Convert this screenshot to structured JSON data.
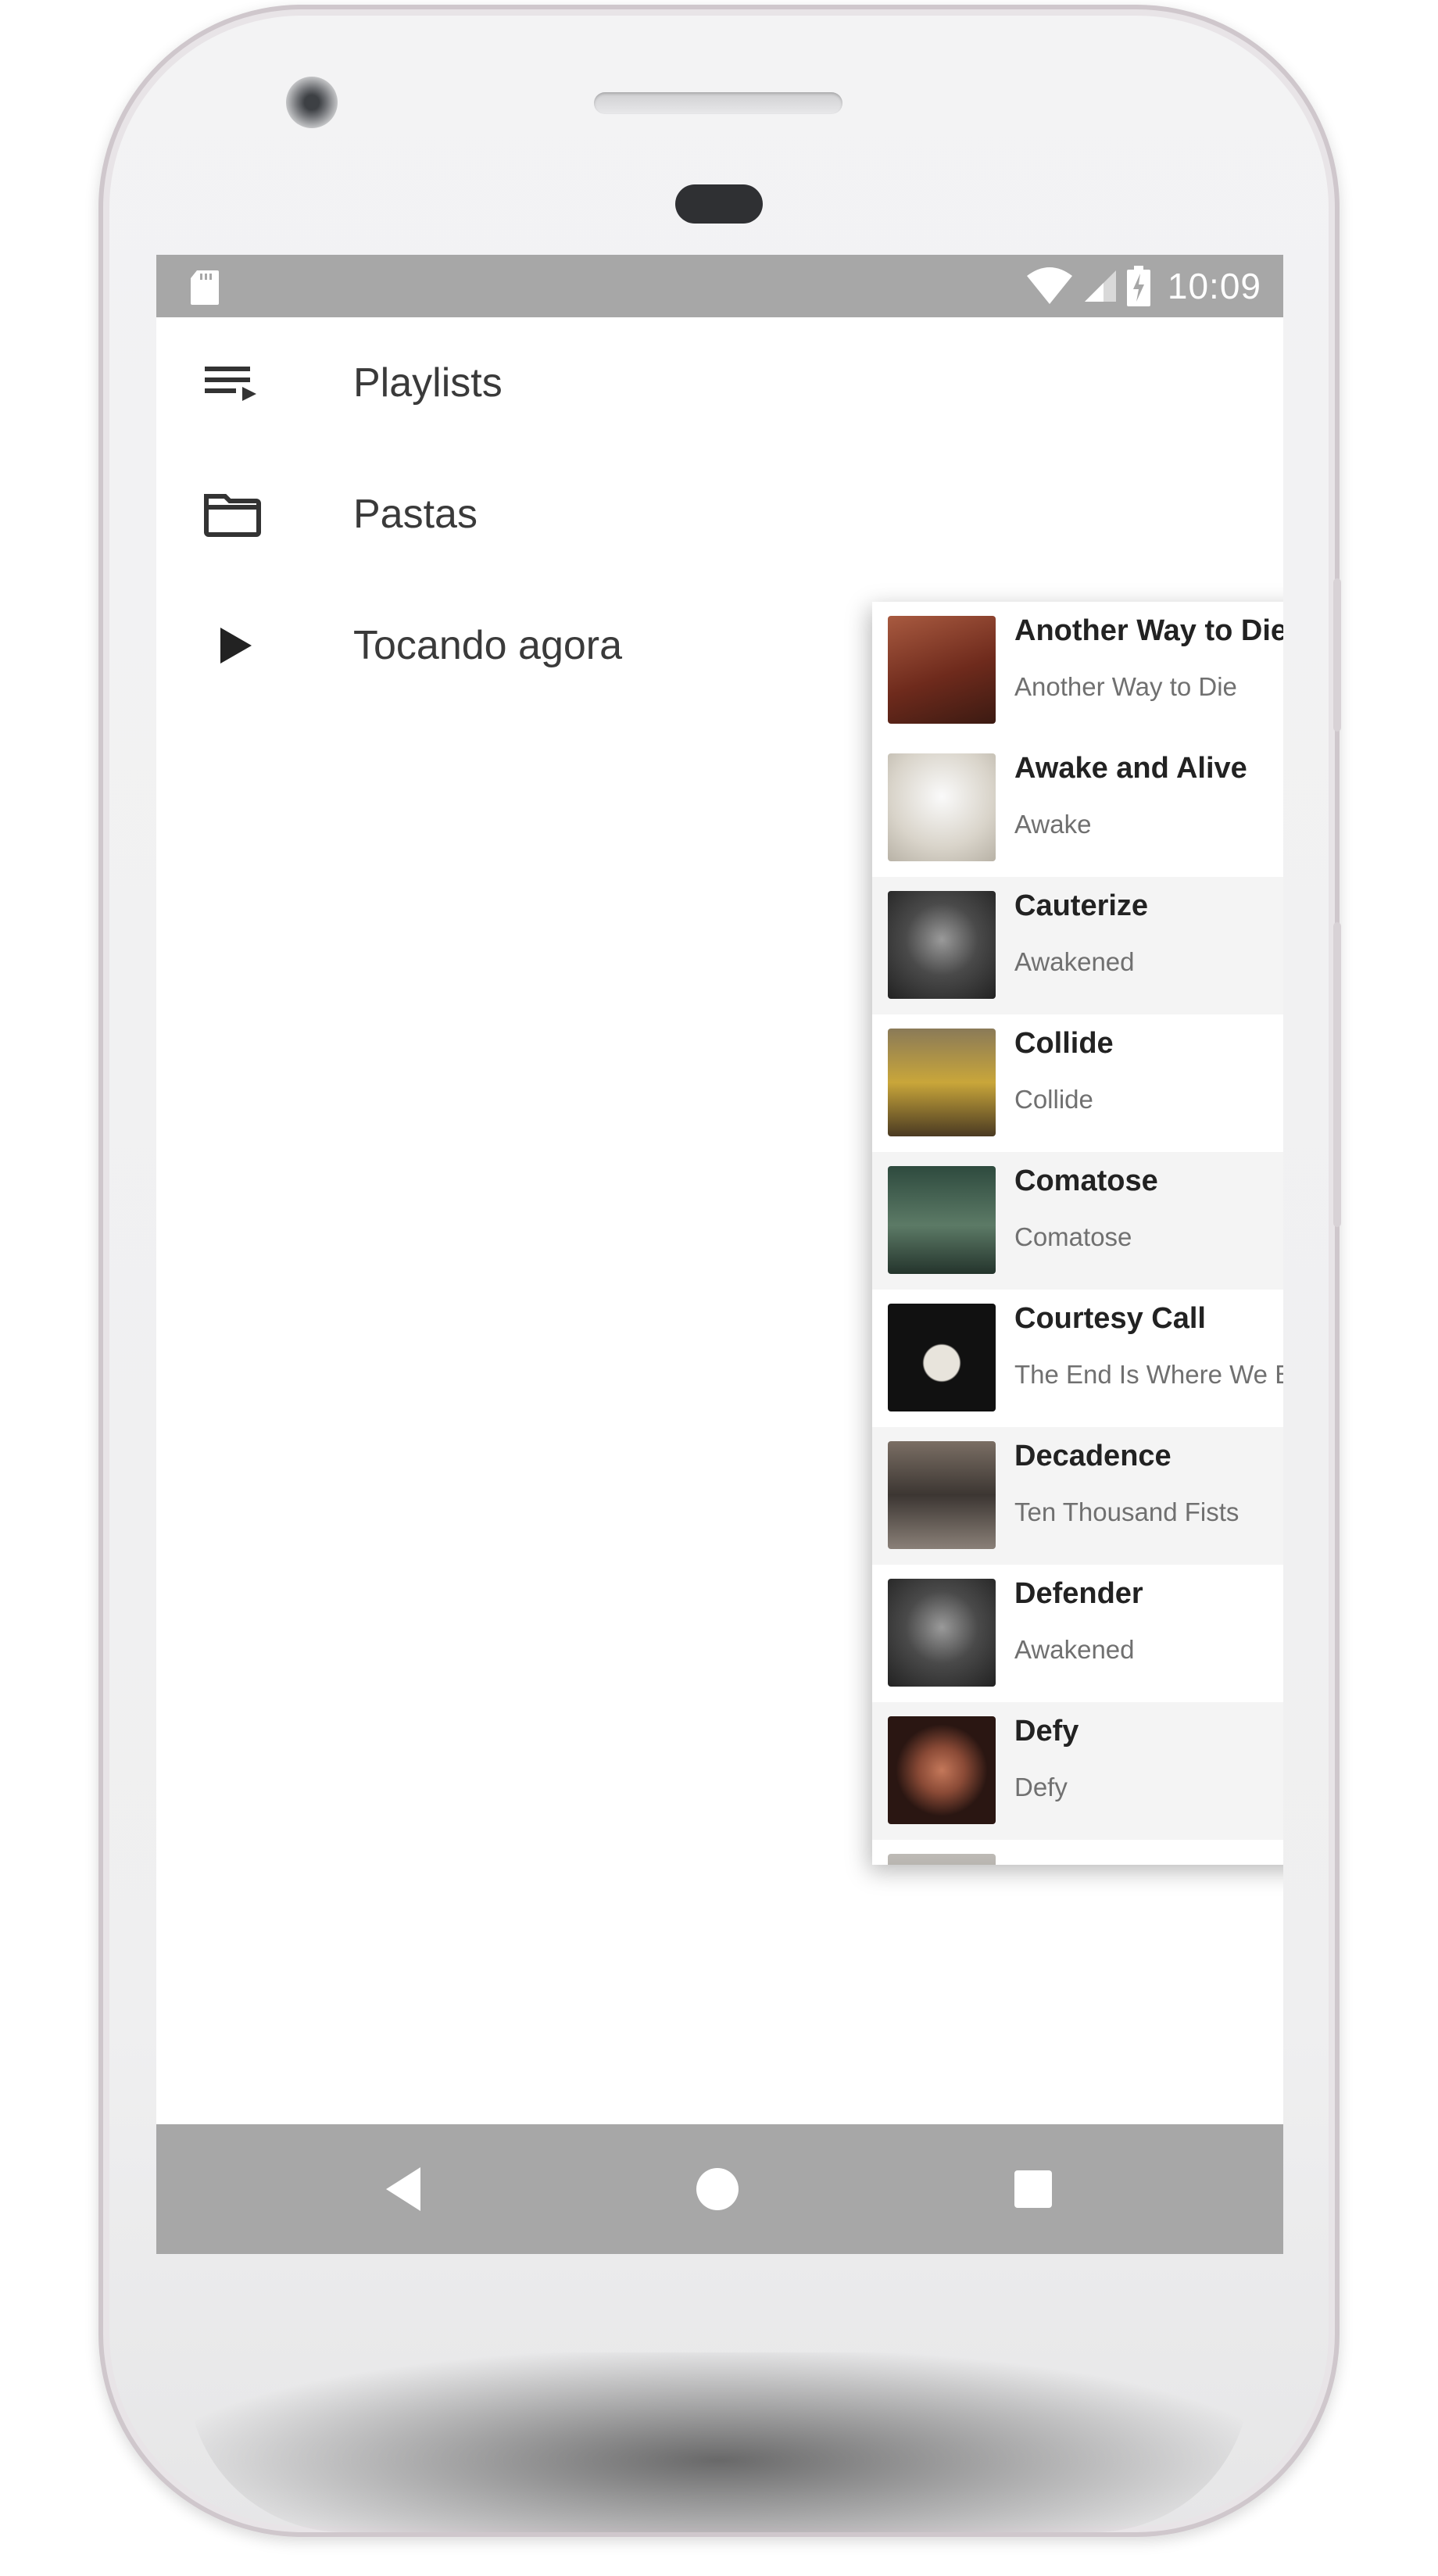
{
  "status_bar": {
    "time": "10:09",
    "icons": [
      "sd-card-icon",
      "wifi-icon",
      "signal-icon",
      "battery-charging-icon"
    ]
  },
  "drawer": {
    "items": [
      {
        "label": "Playlists",
        "icon": "playlist-icon"
      },
      {
        "label": "Pastas",
        "icon": "folder-icon"
      },
      {
        "label": "Tocando agora",
        "icon": "play-icon"
      }
    ]
  },
  "song_list": {
    "items": [
      {
        "title": "Another Way to Die",
        "subtitle": "Another Way to Die",
        "art_color": "#8a3a2a"
      },
      {
        "title": "Awake and Alive",
        "subtitle": "Awake",
        "art_color": "#e6e2da"
      },
      {
        "title": "Cauterize",
        "subtitle": "Awakened",
        "art_color": "#3a3a3a"
      },
      {
        "title": "Collide",
        "subtitle": "Collide",
        "art_color": "#6b5a3a"
      },
      {
        "title": "Comatose",
        "subtitle": "Comatose",
        "art_color": "#3d5a4a"
      },
      {
        "title": "Courtesy Call",
        "subtitle": "The End Is Where We Begin",
        "art_color": "#141414"
      },
      {
        "title": "Decadence",
        "subtitle": "Ten Thousand Fists",
        "art_color": "#5a5048"
      },
      {
        "title": "Defender",
        "subtitle": "Awakened",
        "art_color": "#3a3a3a"
      },
      {
        "title": "Defy",
        "subtitle": "Defy",
        "art_color": "#3a1e18"
      }
    ]
  },
  "nav_bar": {
    "buttons": [
      "back-icon",
      "home-icon",
      "recents-icon"
    ]
  },
  "colors": {
    "system_bar": "#a7a7a7",
    "screen_bg": "#ffffff",
    "list_shade": "#f4f4f4",
    "title_text": "#222222",
    "subtitle_text": "#707070"
  }
}
